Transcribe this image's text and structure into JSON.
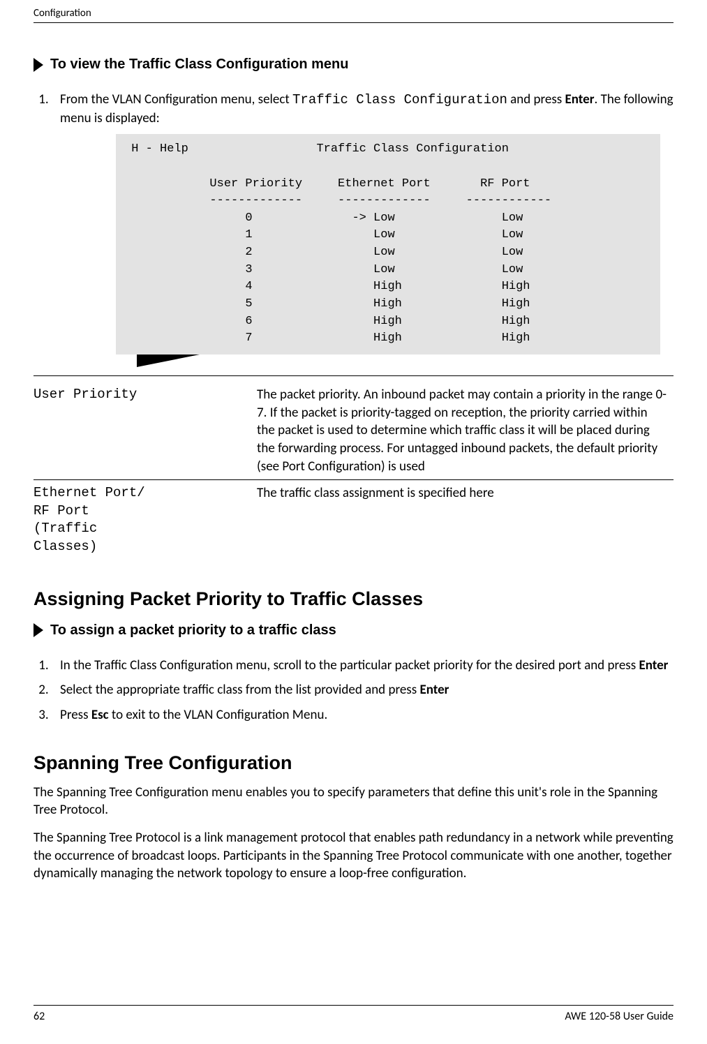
{
  "header": {
    "running": "Configuration"
  },
  "proc1": {
    "title": "To view the Traffic Class Configuration menu",
    "step1_pre": "From the VLAN Configuration menu, select ",
    "step1_code": "Traffic Class Configuration",
    "step1_mid": " and press ",
    "step1_key": "Enter",
    "step1_post": ". The following menu is displayed:"
  },
  "terminal": " H - Help                  Traffic Class Configuration\n\n            User Priority     Ethernet Port       RF Port\n            -------------     -------------     ------------\n                 0              -> Low               Low\n                 1                 Low               Low\n                 2                 Low               Low\n                 3                 Low               Low\n                 4                 High              High\n                 5                 High              High\n                 6                 High              High\n                 7                 High              High",
  "defs": [
    {
      "term": "User Priority",
      "desc": "The packet priority. An inbound packet may contain a priority in the range 0-7. If the packet is priority-tagged on reception, the priority carried within the packet is used to determine which traffic class it will be placed during the forwarding process. For untagged inbound packets, the default priority (see Port Configuration) is used"
    },
    {
      "term": "Ethernet Port/\nRF Port\n(Traffic\nClasses)",
      "desc": "The traffic class assignment is specified here"
    }
  ],
  "h2a": "Assigning Packet Priority to Traffic Classes",
  "proc2": {
    "title": "To assign a packet priority to a traffic class",
    "s1a": "In the Traffic Class Configuration menu, scroll to the particular packet priority for the desired port  and press ",
    "s1b": "Enter",
    "s2a": "Select the appropriate traffic class from the list provided and press ",
    "s2b": "Enter",
    "s3a": "Press ",
    "s3b": "Esc",
    "s3c": " to exit to the VLAN Configuration Menu."
  },
  "h2b": "Spanning Tree Configuration",
  "p1": "The Spanning Tree Configuration menu enables you to specify parameters that define this unit's role in the Spanning Tree Protocol.",
  "p2": "The Spanning Tree Protocol is a link management protocol that enables path redundancy in a network while preventing the occurrence of broadcast loops.   Participants in the Spanning Tree Protocol communicate with one another, together dynamically managing the network topology to ensure a loop-free configuration.",
  "footer": {
    "page": "62",
    "guide": "AWE 120-58 User Guide"
  },
  "chart_data": {
    "type": "table",
    "title": "Traffic Class Configuration",
    "columns": [
      "User Priority",
      "Ethernet Port",
      "RF Port"
    ],
    "rows": [
      [
        "0",
        "Low",
        "Low"
      ],
      [
        "1",
        "Low",
        "Low"
      ],
      [
        "2",
        "Low",
        "Low"
      ],
      [
        "3",
        "Low",
        "Low"
      ],
      [
        "4",
        "High",
        "High"
      ],
      [
        "5",
        "High",
        "High"
      ],
      [
        "6",
        "High",
        "High"
      ],
      [
        "7",
        "High",
        "High"
      ]
    ],
    "selected_row_index": 0,
    "help_hint": "H - Help"
  }
}
